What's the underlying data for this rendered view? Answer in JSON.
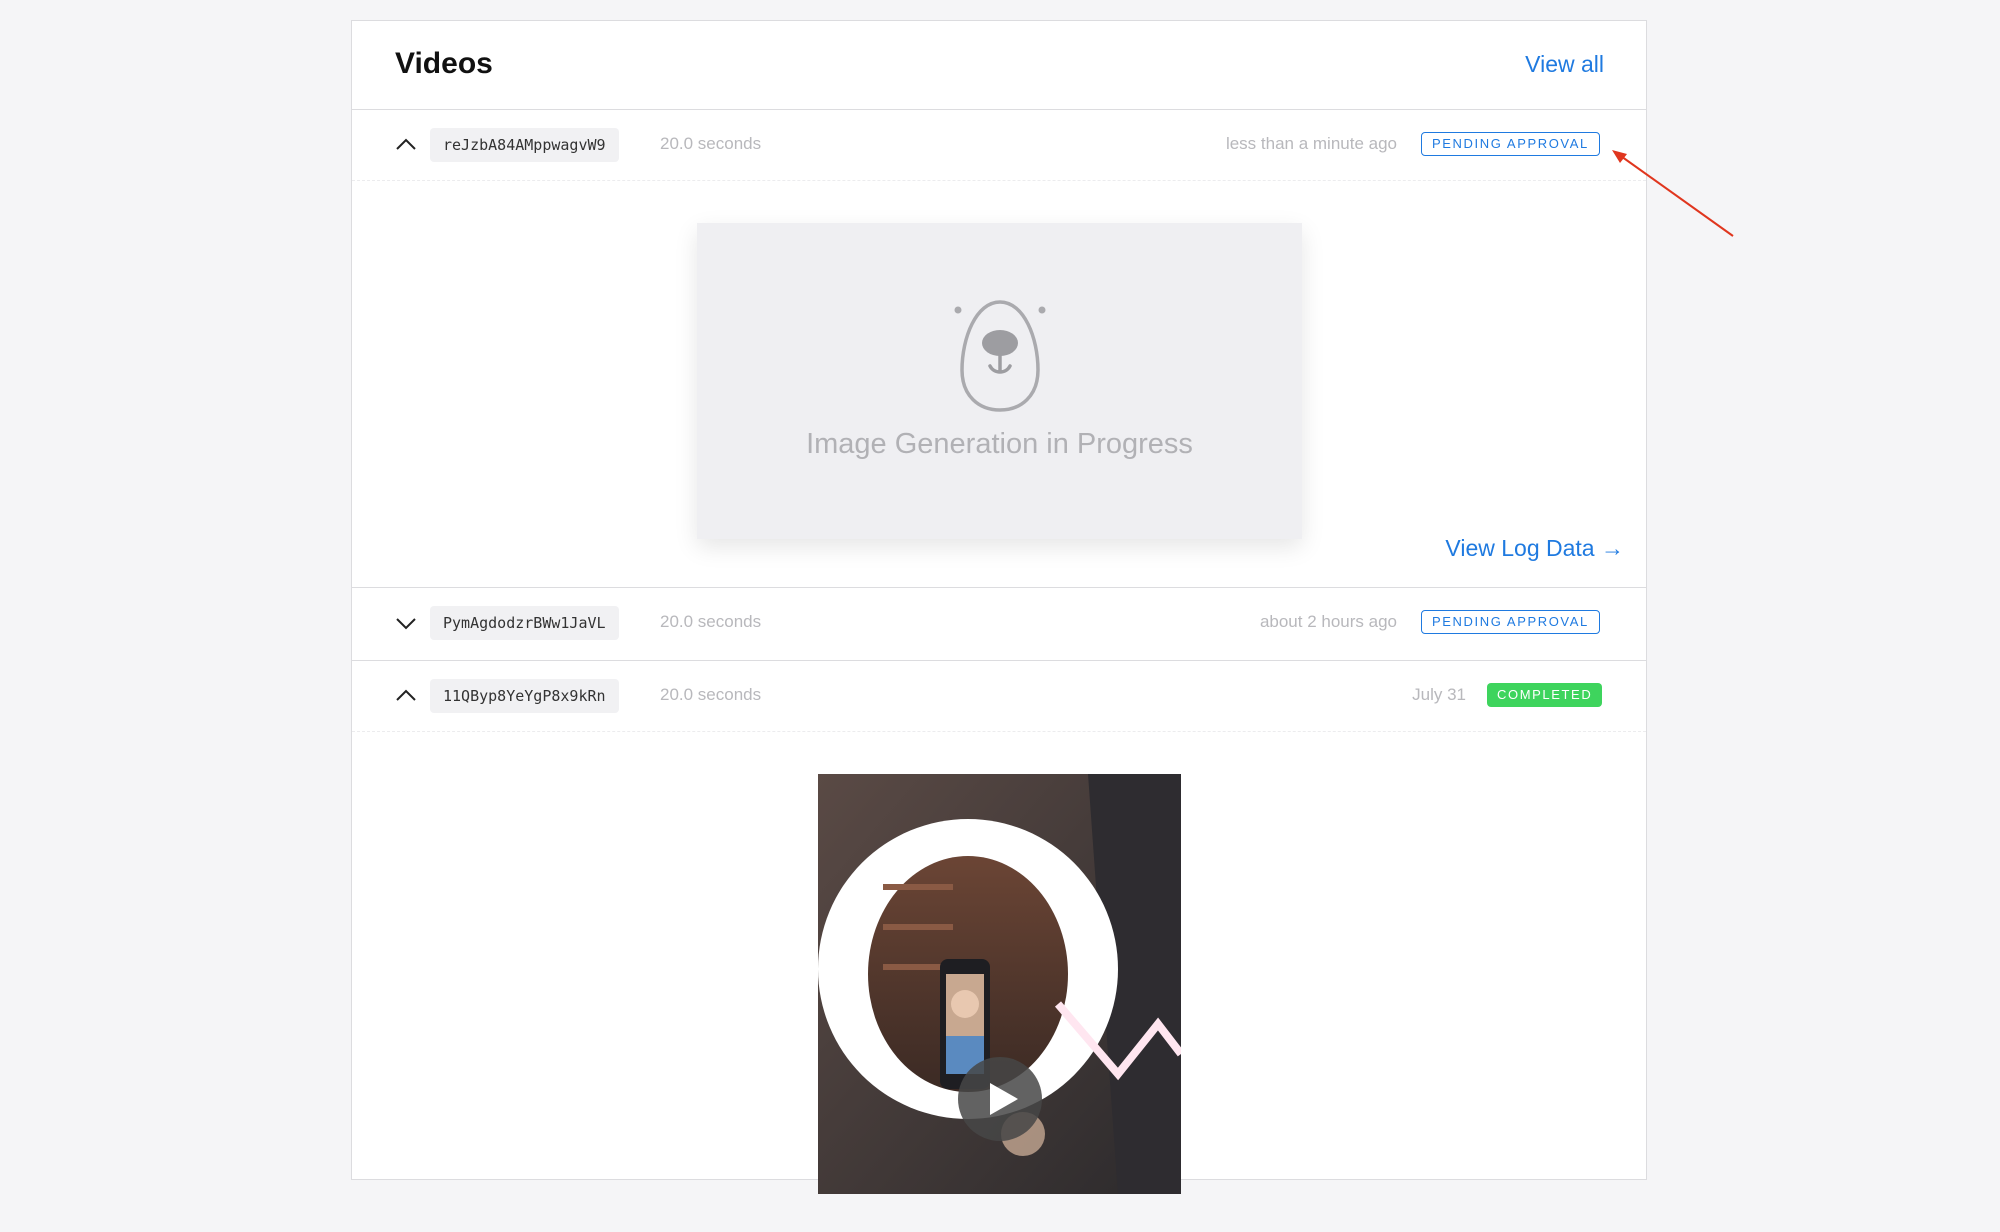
{
  "header": {
    "title": "Videos",
    "view_all_label": "View all"
  },
  "videos": [
    {
      "id": "reJzbA84AMppwagvW9",
      "duration": "20.0 seconds",
      "time_ago": "less than a minute ago",
      "status": "PENDING APPROVAL",
      "expanded": true,
      "placeholder_text": "Image Generation in Progress",
      "log_link_label": "View Log Data →"
    },
    {
      "id": "PymAgdodzrBWw1JaVL",
      "duration": "20.0 seconds",
      "time_ago": "about 2 hours ago",
      "status": "PENDING APPROVAL",
      "expanded": false
    },
    {
      "id": "11QByp8YeYgP8x9kRn",
      "duration": "20.0 seconds",
      "time_ago": "July 31",
      "status": "COMPLETED",
      "expanded": true
    }
  ],
  "colors": {
    "accent": "#1f7ae0",
    "completed": "#3ed45d",
    "annotation_arrow": "#e0361e"
  },
  "icons": [
    "chevron-up-icon",
    "chevron-down-icon",
    "bear-icon",
    "play-icon",
    "arrow-annotation-icon"
  ]
}
